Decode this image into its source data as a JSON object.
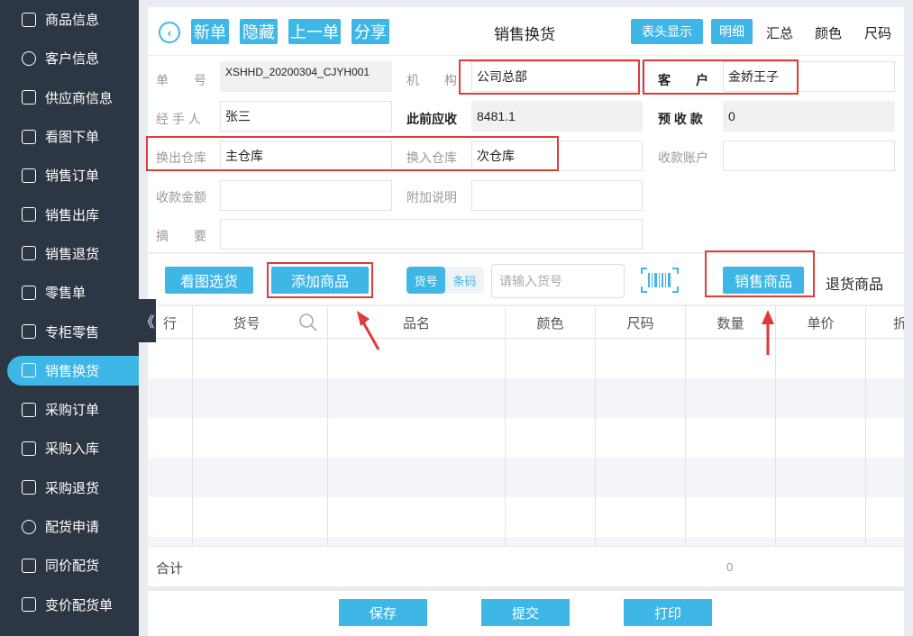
{
  "sidebar": {
    "items": [
      {
        "label": "商品信息",
        "icon": "product-info-icon"
      },
      {
        "label": "客户信息",
        "icon": "customer-icon"
      },
      {
        "label": "供应商信息",
        "icon": "supplier-icon"
      },
      {
        "label": "看图下单",
        "icon": "picture-order-icon"
      },
      {
        "label": "销售订单",
        "icon": "sales-order-icon"
      },
      {
        "label": "销售出库",
        "icon": "sales-out-icon"
      },
      {
        "label": "销售退货",
        "icon": "sales-return-icon"
      },
      {
        "label": "零售单",
        "icon": "retail-icon"
      },
      {
        "label": "专柜零售",
        "icon": "counter-retail-icon"
      },
      {
        "label": "销售换货",
        "icon": "sales-exchange-icon"
      },
      {
        "label": "采购订单",
        "icon": "purchase-order-icon"
      },
      {
        "label": "采购入库",
        "icon": "purchase-in-icon"
      },
      {
        "label": "采购退货",
        "icon": "purchase-return-icon"
      },
      {
        "label": "配货申请",
        "icon": "distribution-request-icon"
      },
      {
        "label": "同价配货",
        "icon": "same-price-icon"
      },
      {
        "label": "变价配货单",
        "icon": "price-change-icon"
      }
    ],
    "active_index": 9,
    "collapse_glyph": "《"
  },
  "topbar": {
    "back_glyph": "‹",
    "new": "新单",
    "hide": "隐藏",
    "prev": "上一单",
    "share": "分享",
    "title": "销售换货",
    "header_show": "表头显示",
    "detail": "明细",
    "summary": "汇总",
    "color": "颜色",
    "size": "尺码"
  },
  "form": {
    "order_no_label": "单　　号",
    "order_no": "XSHHD_20200304_CJYH001",
    "org_label": "机　　构",
    "org": "公司总部",
    "customer_label": "客　　户",
    "customer": "金娇王子",
    "handler_label": "经 手 人",
    "handler": "张三",
    "prev_receivable_label": "此前应收",
    "prev_receivable": "8481.1",
    "advance_label": "预 收 款",
    "advance": "0",
    "out_wh_label": "换出仓库",
    "out_wh": "主仓库",
    "in_wh_label": "换入仓库",
    "in_wh": "次仓库",
    "account_label": "收款账户",
    "amount_label": "收款金额",
    "note_label": "附加说明",
    "summary_label": "摘　　要"
  },
  "actions": {
    "pic_select": "看图选货",
    "add_product": "添加商品",
    "seg_code": "货号",
    "seg_barcode": "条码",
    "search_placeholder": "请输入货号",
    "sales_product": "销售商品",
    "return_product": "退货商品"
  },
  "table": {
    "headers": [
      "行",
      "货号",
      "品名",
      "颜色",
      "尺码",
      "数量",
      "单价",
      "折"
    ]
  },
  "totals": {
    "label": "合计",
    "qty": "0"
  },
  "bottom": {
    "save": "保存",
    "submit": "提交",
    "print": "打印"
  },
  "colors": {
    "accent": "#3fb7e6",
    "sidebar_bg": "#2d3744",
    "highlight": "#e03a3a"
  }
}
